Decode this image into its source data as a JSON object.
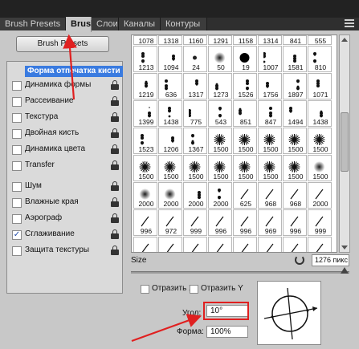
{
  "tabs": [
    {
      "label": "Brush Presets",
      "active": false
    },
    {
      "label": "Brush",
      "active": true
    },
    {
      "label": "Слои",
      "active": false
    },
    {
      "label": "Каналы",
      "active": false
    },
    {
      "label": "Контуры",
      "active": false
    }
  ],
  "presets_button": "Brush Presets",
  "options": {
    "header": "Форма отпечатка кисти",
    "items": [
      {
        "label": "Динамика формы",
        "checked": false,
        "lock": true
      },
      {
        "label": "Рассеивание",
        "checked": false,
        "lock": true
      },
      {
        "label": "Текстура",
        "checked": false,
        "lock": true
      },
      {
        "label": "Двойная кисть",
        "checked": false,
        "lock": true
      },
      {
        "label": "Динамика цвета",
        "checked": false,
        "lock": true
      },
      {
        "label": "Transfer",
        "checked": false,
        "lock": true
      },
      {
        "label": "Шум",
        "checked": false,
        "lock": true
      },
      {
        "label": "Влажные края",
        "checked": false,
        "lock": true
      },
      {
        "label": "Аэрограф",
        "checked": false,
        "lock": true
      },
      {
        "label": "Сглаживание",
        "checked": true,
        "lock": true
      },
      {
        "label": "Защита текстуры",
        "checked": false,
        "lock": true
      }
    ]
  },
  "brush_grid": {
    "rows": [
      [
        "1078",
        "1318",
        "1160",
        "1291",
        "1158",
        "1314",
        "841",
        "555"
      ],
      [
        "1213",
        "1094",
        "24",
        "50",
        "19",
        "1007",
        "1581",
        "810"
      ],
      [
        "1219",
        "636",
        "1317",
        "1273",
        "1526",
        "1756",
        "1897",
        "1071"
      ],
      [
        "1399",
        "1438",
        "775",
        "543",
        "851",
        "847",
        "1494",
        "1438"
      ],
      [
        "1523",
        "1206",
        "1367",
        "1500",
        "1500",
        "1500",
        "1500",
        "1500"
      ],
      [
        "1500",
        "1500",
        "1500",
        "1500",
        "1500",
        "1500",
        "1500",
        "1500"
      ],
      [
        "2000",
        "2000",
        "2000",
        "2000",
        "625",
        "968",
        "968",
        "2000"
      ],
      [
        "996",
        "972",
        "999",
        "996",
        "996",
        "969",
        "996",
        "999"
      ],
      [
        "",
        "",
        "",
        "",
        "",
        "",
        "",
        ""
      ]
    ],
    "marks": [
      [
        "",
        "",
        "",
        "",
        "",
        "",
        "",
        ""
      ],
      [
        "splatter",
        "splatter",
        "tiny-dot",
        "soft-dot",
        "hard-dot",
        "splatter",
        "splatter",
        "splatter"
      ],
      [
        "splatter",
        "splatter",
        "splatter",
        "splatter",
        "splatter",
        "splatter",
        "splatter",
        "splatter"
      ],
      [
        "splatter",
        "splatter",
        "splatter",
        "splatter",
        "splatter",
        "splatter",
        "splatter",
        "splatter"
      ],
      [
        "splatter",
        "splatter",
        "splatter",
        "starburst",
        "starburst",
        "starburst",
        "starburst",
        "starburst"
      ],
      [
        "starburst",
        "starburst",
        "starburst",
        "starburst",
        "starburst",
        "starburst",
        "starburst",
        "soft-dot"
      ],
      [
        "soft-dot",
        "soft-dot",
        "splatter",
        "splatter",
        "stroke",
        "stroke",
        "stroke",
        "stroke"
      ],
      [
        "stroke",
        "stroke",
        "stroke",
        "stroke",
        "stroke",
        "stroke",
        "stroke",
        "stroke"
      ],
      [
        "stroke",
        "stroke",
        "stroke",
        "stroke",
        "stroke",
        "stroke",
        "stroke",
        "stroke"
      ]
    ]
  },
  "size": {
    "label": "Size",
    "value": "1276 пикс"
  },
  "flip_x": {
    "label": "Отразить X",
    "checked": false
  },
  "flip_y": {
    "label": "Отразить Y",
    "checked": false
  },
  "angle": {
    "label": "Угол:",
    "value": "10°"
  },
  "roundness": {
    "label": "Форма:",
    "value": "100%"
  },
  "colors": {
    "highlight": "#3a7be0",
    "annotation": "#e02020"
  }
}
